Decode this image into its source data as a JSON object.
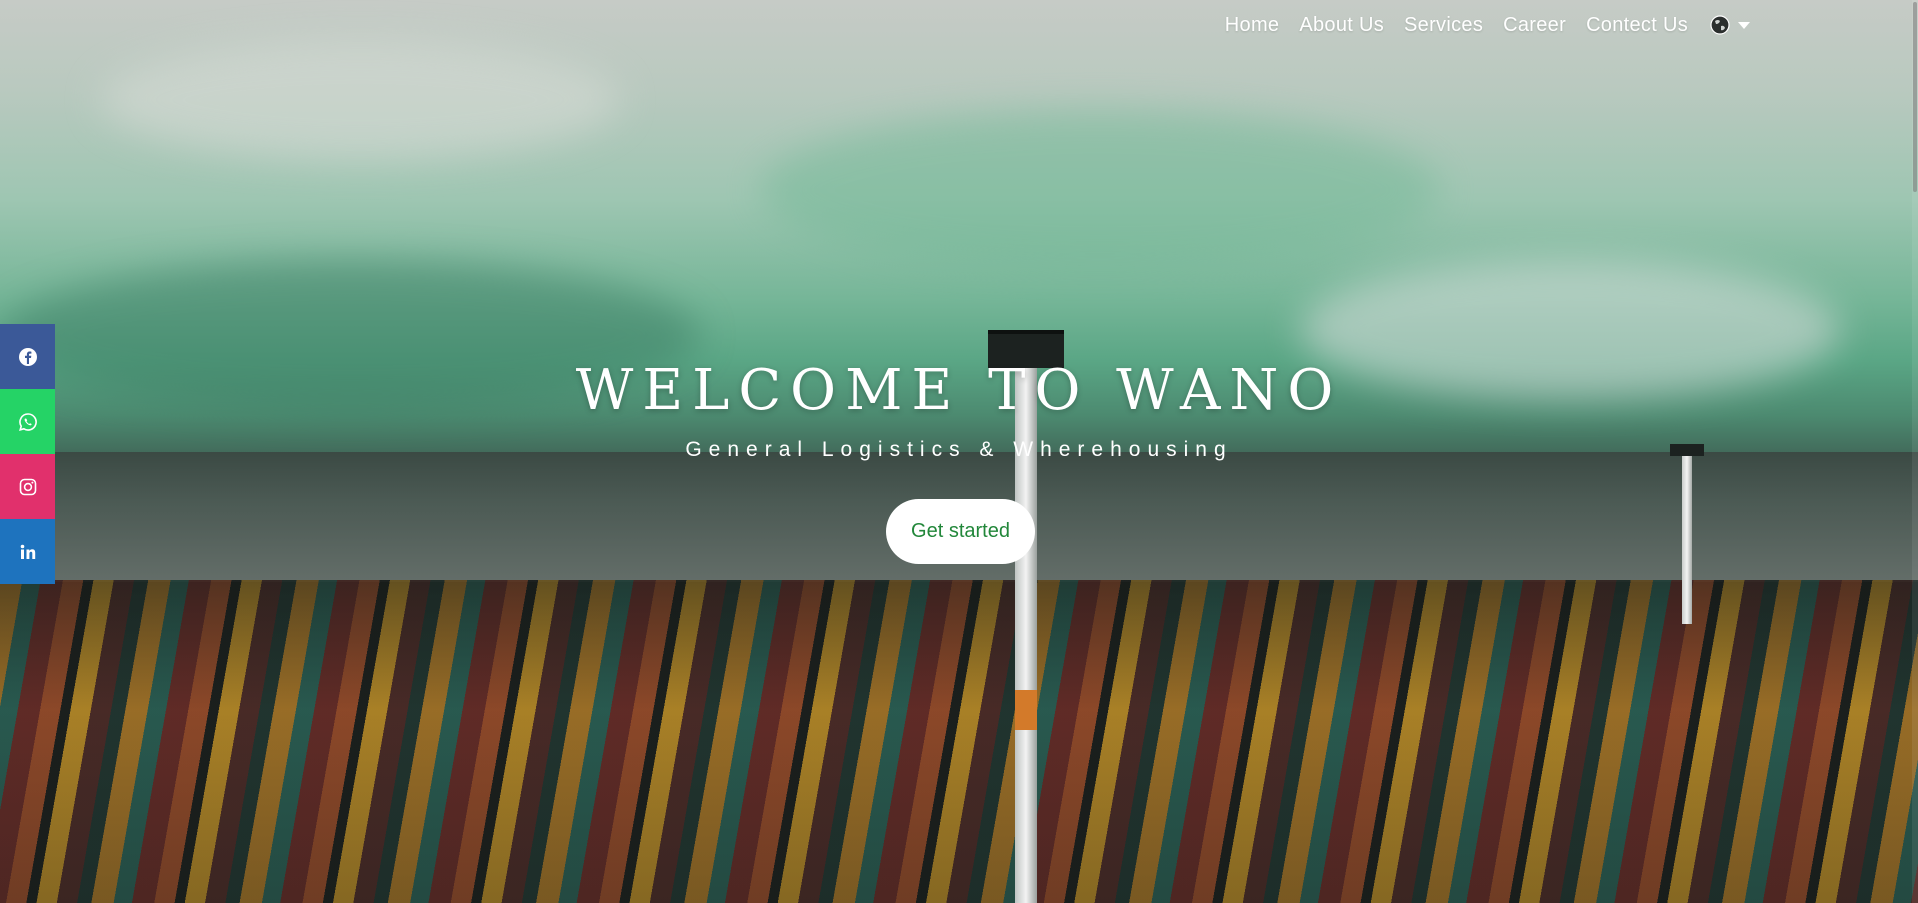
{
  "nav": {
    "items": [
      {
        "label": "Home"
      },
      {
        "label": "About Us"
      },
      {
        "label": "Services"
      },
      {
        "label": "Career"
      },
      {
        "label": "Contect Us"
      }
    ],
    "language_icon": "globe-icon",
    "language_caret_icon": "caret-down-icon"
  },
  "hero": {
    "title": "WELCOME TO WANO",
    "subtitle": "General Logistics & Wherehousing",
    "cta_label": "Get started"
  },
  "social": [
    {
      "icon": "facebook-icon",
      "color": "#3b5998"
    },
    {
      "icon": "whatsapp-icon",
      "color": "#25d366"
    },
    {
      "icon": "instagram-icon",
      "color": "#e1306c"
    },
    {
      "icon": "linkedin-icon",
      "color": "#1e73be"
    }
  ],
  "colors": {
    "cta_text": "#22873a",
    "cta_background": "#ffffff"
  }
}
